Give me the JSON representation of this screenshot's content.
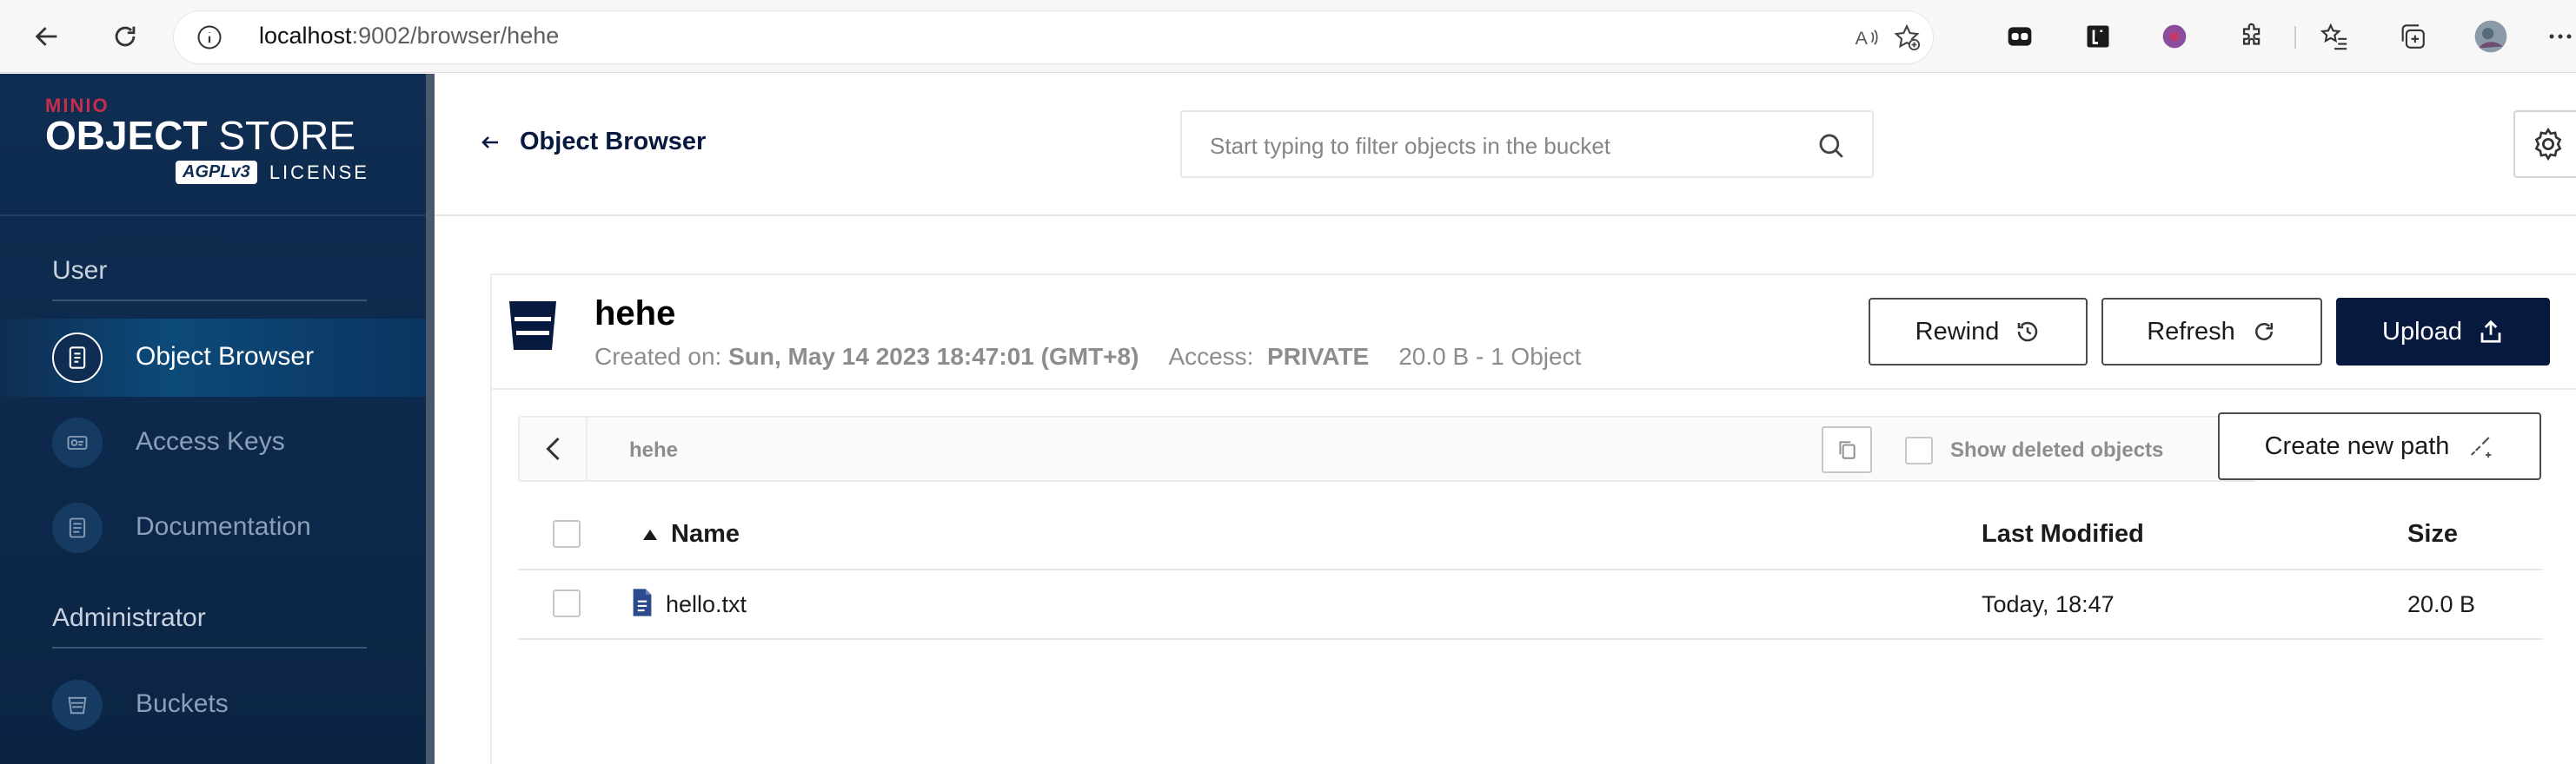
{
  "browser": {
    "url_host": "localhost",
    "url_rest": ":9002/browser/hehe",
    "icons": [
      "back-icon",
      "refresh-icon",
      "info-icon",
      "read-aloud-icon",
      "favorite-add-icon",
      "extension-icons",
      "puzzle-icon",
      "favorites-icon",
      "collections-icon",
      "profile-avatar",
      "more-icon"
    ]
  },
  "logo": {
    "brand": "MINIO",
    "product_bold": "OBJECT",
    "product_rest": " STORE",
    "agpl": "AGPLv3",
    "license": "LICENSE"
  },
  "sidebar": {
    "user_section": "User",
    "admin_section": "Administrator",
    "items": [
      {
        "label": "Object Browser",
        "icon": "object-browser-icon",
        "active": true
      },
      {
        "label": "Access Keys",
        "icon": "access-keys-icon",
        "active": false
      },
      {
        "label": "Documentation",
        "icon": "documentation-icon",
        "active": false
      },
      {
        "label": "Buckets",
        "icon": "buckets-icon",
        "active": false
      }
    ]
  },
  "topbar": {
    "back_label": "Object Browser",
    "search_placeholder": "Start typing to filter objects in the bucket"
  },
  "bucket": {
    "name": "hehe",
    "created_label": "Created on:",
    "created_value": "Sun, May 14 2023 18:47:01 (GMT+8)",
    "access_label": "Access:",
    "access_value": "PRIVATE",
    "usage": "20.0 B - 1 Object",
    "buttons": {
      "rewind": "Rewind",
      "refresh": "Refresh",
      "upload": "Upload"
    }
  },
  "breadcrumb": {
    "path": "hehe",
    "show_deleted": "Show deleted objects",
    "create_new_path": "Create new path"
  },
  "table": {
    "columns": [
      "Name",
      "Last Modified",
      "Size"
    ],
    "sort_column": "Name",
    "rows": [
      {
        "name": "hello.txt",
        "last_modified": "Today, 18:47",
        "size": "20.0 B"
      }
    ]
  },
  "colors": {
    "sidebar_bg": "#0f2d52",
    "primary": "#07193e",
    "brand_red": "#c72e49"
  }
}
